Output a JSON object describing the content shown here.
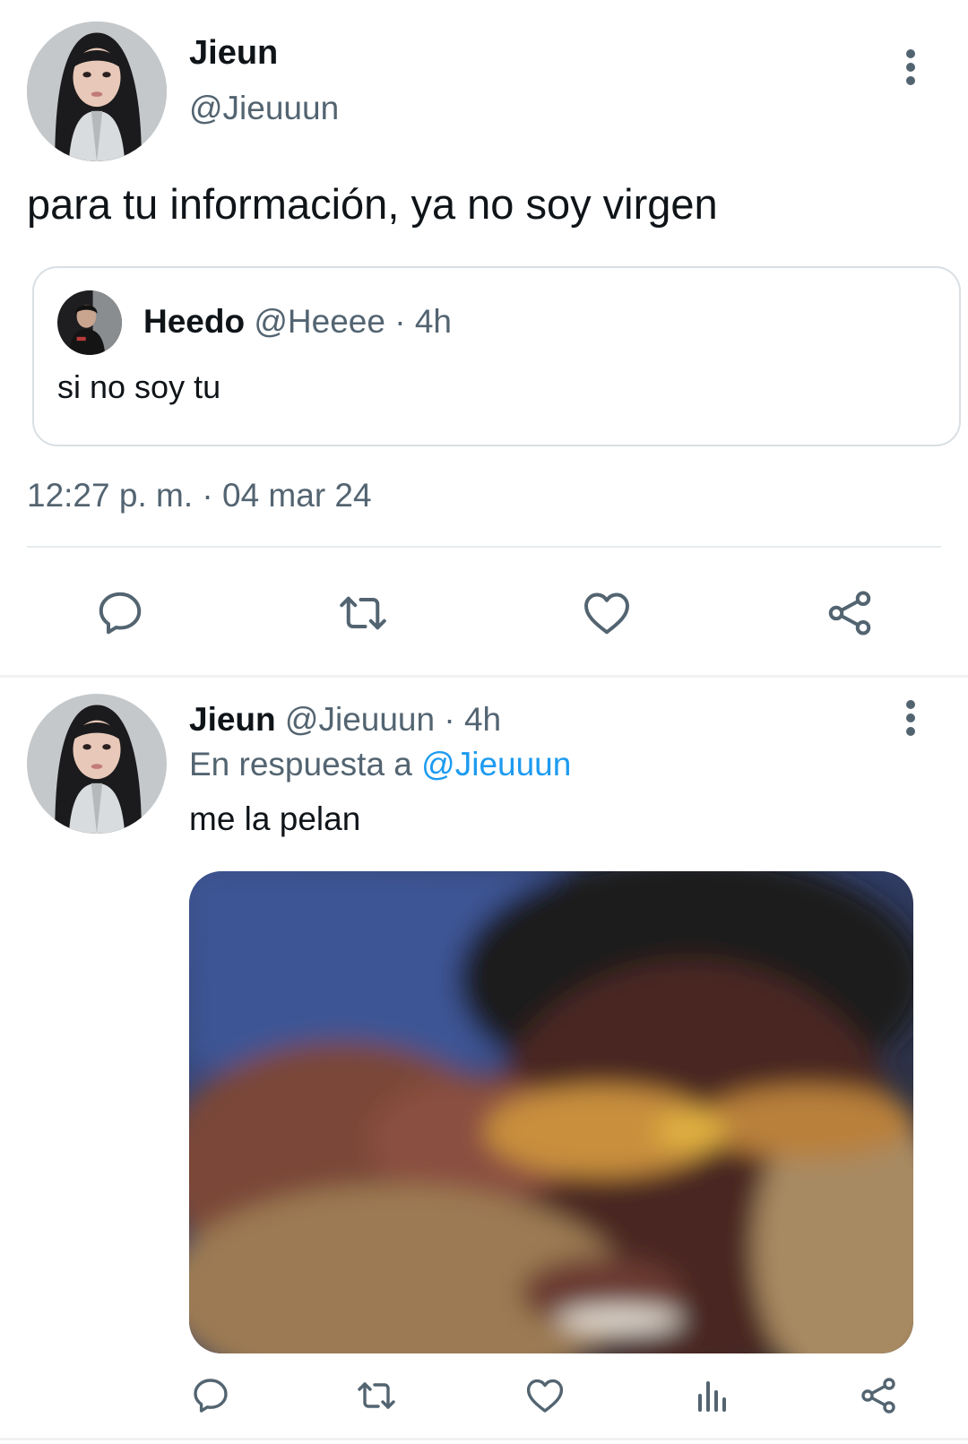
{
  "tweet": {
    "author": {
      "name": "Jieun",
      "handle": "@Jieuuun"
    },
    "text": "para tu información, ya no soy virgen",
    "quote": {
      "name": "Heedo",
      "meta": "@Heeee · 4h",
      "text": "si no soy tu"
    },
    "timestamp": "12:27 p. m. · 04 mar 24",
    "actions": [
      "reply-icon",
      "retweet-icon",
      "like-icon",
      "share-icon"
    ]
  },
  "reply": {
    "author": {
      "name": "Jieun",
      "meta": "@Jieuuun · 4h"
    },
    "replying_to_prefix": "En respuesta a",
    "replying_to_handle": "@Jieuuun",
    "text": "me la pelan",
    "actions": [
      "reply-icon",
      "retweet-icon",
      "like-icon",
      "views-icon",
      "share-icon"
    ]
  },
  "colors": {
    "text": "#0f1419",
    "secondary": "#536471",
    "link": "#1d9bf0",
    "border": "#d9dfe3"
  }
}
